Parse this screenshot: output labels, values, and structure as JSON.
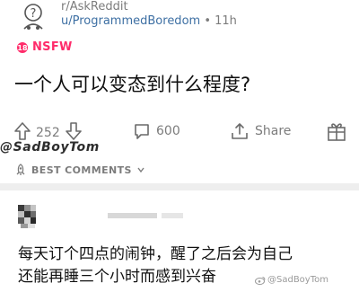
{
  "header": {
    "subreddit": "r/AskReddit",
    "user": "u/ProgrammedBoredom",
    "time": "11h",
    "separator": "•"
  },
  "post": {
    "badge": "NSFW",
    "title": "一个人可以变态到什么程度?"
  },
  "actions": {
    "votes": "252",
    "comments": "600",
    "share": "Share"
  },
  "watermark_top": "@SadBoyTom",
  "sort": {
    "label": "BEST COMMENTS"
  },
  "comment": {
    "line1": "每天订个四点的闹钟，醒了之后会为自己",
    "line2": "还能再睡三个小时而感到兴奋"
  },
  "watermark_bottom": "@SadBoyTom",
  "colors": {
    "nsfw": "#ff2b6a",
    "user": "#3d6fa3",
    "muted": "#7c7c7c"
  }
}
